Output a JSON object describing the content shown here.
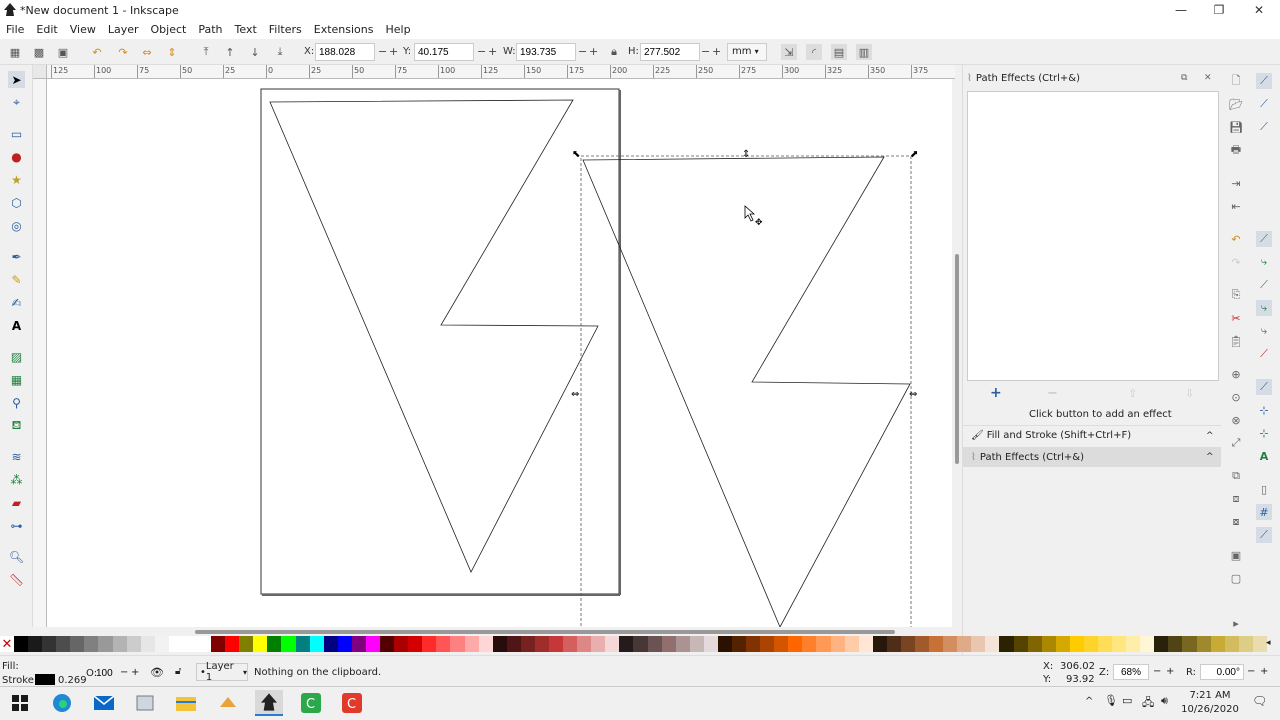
{
  "window": {
    "title": "*New document 1 - Inkscape",
    "controls": [
      "—",
      "❐",
      "✕"
    ]
  },
  "menu": [
    "File",
    "Edit",
    "View",
    "Layer",
    "Object",
    "Path",
    "Text",
    "Filters",
    "Extensions",
    "Help"
  ],
  "toolbar": {
    "x_label": "X:",
    "x_value": "188.028",
    "y_label": "Y:",
    "y_value": "40.175",
    "w_label": "W:",
    "w_value": "193.735",
    "h_label": "H:",
    "h_value": "277.502",
    "unit": "mm",
    "spin_minus": "−",
    "spin_plus": "+",
    "lock_icon": "lock-icon"
  },
  "rulers": {
    "top_ticks": [
      "125",
      "100",
      "75",
      "50",
      "25",
      "0",
      "25",
      "50",
      "75",
      "100",
      "125",
      "150",
      "175",
      "200",
      "225",
      "250",
      "275",
      "300",
      "325",
      "350",
      "375"
    ]
  },
  "dock": {
    "panel_title": "Path Effects (Ctrl+&)",
    "add": "+",
    "remove": "−",
    "hint": "Click button to add an effect",
    "fill_stroke": "Fill and Stroke (Shift+Ctrl+F)",
    "path_effects": "Path Effects (Ctrl+&)",
    "chevron": "^"
  },
  "status": {
    "fill_label": "Fill:",
    "stroke_label": "Stroke:",
    "stroke_width": "0.269",
    "opacity_label": "O:",
    "opacity_value": "100",
    "layer": "Layer 1",
    "message": "Nothing on the clipboard.",
    "cursor_x_label": "X:",
    "cursor_x": "306.02",
    "cursor_y_label": "Y:",
    "cursor_y": "93.92",
    "zoom_label": "Z:",
    "zoom_value": "68%",
    "rotate_label": "R:",
    "rotate_value": "0.00°"
  },
  "taskbar": {
    "time": "7:21 AM",
    "date": "10/26/2020"
  },
  "palette": [
    "#000000",
    "#1a1a1a",
    "#333333",
    "#4d4d4d",
    "#666666",
    "#808080",
    "#999999",
    "#b3b3b3",
    "#cccccc",
    "#e6e6e6",
    "#f2f2f2",
    "#ffffff",
    "#ffffff",
    "#ffffff",
    "#800000",
    "#ff0000",
    "#808000",
    "#ffff00",
    "#008000",
    "#00ff00",
    "#008080",
    "#00ffff",
    "#000080",
    "#0000ff",
    "#800080",
    "#ff00ff",
    "#550000",
    "#aa0000",
    "#d40000",
    "#ff2a2a",
    "#ff5555",
    "#ff8080",
    "#ffaaaa",
    "#ffd5d5",
    "#280b0b",
    "#501616",
    "#782121",
    "#a02c2c",
    "#c83737",
    "#d35f5f",
    "#de8787",
    "#e9afaf",
    "#f4d7d7",
    "#241c1c",
    "#483737",
    "#6c5353",
    "#916f6f",
    "#ac9393",
    "#c8b7b7",
    "#e3dbdb",
    "#2b1100",
    "#552200",
    "#803300",
    "#aa4400",
    "#d45500",
    "#ff6600",
    "#ff7f2a",
    "#ff9955",
    "#ffb380",
    "#ffccaa",
    "#ffe6d5",
    "#28170b",
    "#502d16",
    "#784421",
    "#a05a2c",
    "#c87137",
    "#d38d5f",
    "#deaa87",
    "#e9c6af",
    "#f4e3d7",
    "#2b2200",
    "#554400",
    "#806600",
    "#aa8800",
    "#d4aa00",
    "#ffcc00",
    "#ffd42a",
    "#ffdd55",
    "#ffe680",
    "#ffeeaa",
    "#fff6d5",
    "#28220b",
    "#504416",
    "#786721",
    "#a0892c",
    "#c8ab37",
    "#d3bc5f",
    "#decd87",
    "#e9ddaf"
  ]
}
